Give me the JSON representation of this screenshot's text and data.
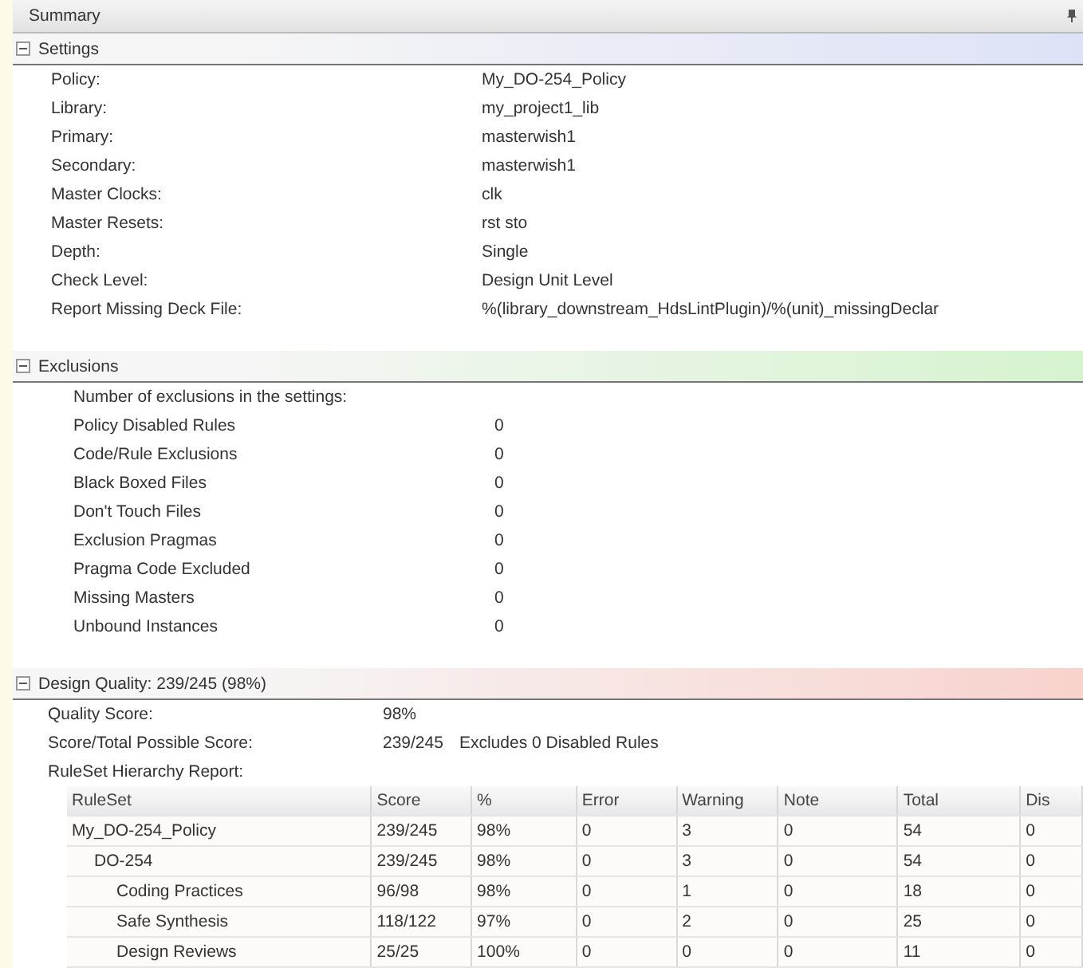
{
  "summary": {
    "title": "Summary"
  },
  "sections": [
    {
      "kind": "pairs",
      "title": "Settings",
      "color": "#dde2f6",
      "expanded": true,
      "rows": [
        {
          "label": "Policy:",
          "value": "My_DO-254_Policy"
        },
        {
          "label": "Library:",
          "value": "my_project1_lib"
        },
        {
          "label": "Primary:",
          "value": "masterwish1"
        },
        {
          "label": "Secondary:",
          "value": "masterwish1"
        },
        {
          "label": "Master Clocks:",
          "value": "clk"
        },
        {
          "label": "Master Resets:",
          "value": "rst sto"
        },
        {
          "label": "Depth:",
          "value": "Single"
        },
        {
          "label": "Check Level:",
          "value": "Design Unit Level"
        },
        {
          "label": "Report Missing Deck File:",
          "value": "%(library_downstream_HdsLintPlugin)/%(unit)_missingDeclar"
        }
      ]
    },
    {
      "kind": "exclusions",
      "title": "Exclusions",
      "color": "#d6f3cf",
      "expanded": true,
      "intro": "Number of exclusions in the settings:",
      "rows": [
        {
          "label": "Policy Disabled Rules",
          "value": "0"
        },
        {
          "label": "Code/Rule Exclusions",
          "value": "0"
        },
        {
          "label": "Black Boxed Files",
          "value": "0"
        },
        {
          "label": "Don't Touch Files",
          "value": "0"
        },
        {
          "label": "Exclusion Pragmas",
          "value": "0"
        },
        {
          "label": "Pragma Code Excluded",
          "value": "0"
        },
        {
          "label": "Missing Masters",
          "value": "0"
        },
        {
          "label": "Unbound Instances",
          "value": "0"
        }
      ]
    },
    {
      "kind": "quality",
      "title": "Design Quality: 239/245 (98%)",
      "color": "#f8d2cd",
      "expanded": true,
      "rows": [
        {
          "label": "Quality Score:",
          "value": "98%"
        },
        {
          "label": "Score/Total Possible Score:",
          "value": "239/245",
          "note": "Excludes 0 Disabled Rules"
        },
        {
          "label": "RuleSet Hierarchy Report:"
        }
      ],
      "table": {
        "columns": [
          "RuleSet",
          "Score",
          "%",
          "Error",
          "Warning",
          "Note",
          "Total",
          "Dis"
        ],
        "rows": [
          {
            "cells": [
              "My_DO-254_Policy",
              "239/245",
              "98%",
              "0",
              "3",
              "0",
              "54",
              "0"
            ],
            "children": [
              {
                "cells": [
                  "DO-254",
                  "239/245",
                  "98%",
                  "0",
                  "3",
                  "0",
                  "54",
                  "0"
                ],
                "children": [
                  {
                    "cells": [
                      "Coding Practices",
                      "96/98",
                      "98%",
                      "0",
                      "1",
                      "0",
                      "18",
                      "0"
                    ]
                  },
                  {
                    "cells": [
                      "Safe Synthesis",
                      "118/122",
                      "97%",
                      "0",
                      "2",
                      "0",
                      "25",
                      "0"
                    ]
                  },
                  {
                    "cells": [
                      "Design Reviews",
                      "25/25",
                      "100%",
                      "0",
                      "0",
                      "0",
                      "11",
                      "0"
                    ]
                  }
                ]
              }
            ]
          }
        ]
      }
    }
  ]
}
